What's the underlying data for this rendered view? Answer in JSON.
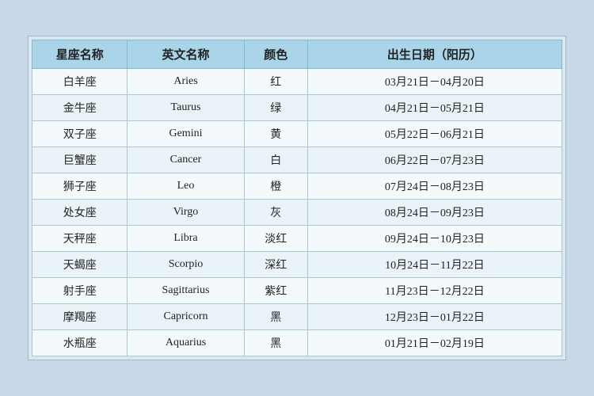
{
  "table": {
    "headers": {
      "zh_name": "星座名称",
      "en_name": "英文名称",
      "color": "颜色",
      "date": "出生日期（阳历）"
    },
    "rows": [
      {
        "zh": "白羊座",
        "en": "Aries",
        "color": "红",
        "date": "03月21日－04月20日"
      },
      {
        "zh": "金牛座",
        "en": "Taurus",
        "color": "绿",
        "date": "04月21日－05月21日"
      },
      {
        "zh": "双子座",
        "en": "Gemini",
        "color": "黄",
        "date": "05月22日－06月21日"
      },
      {
        "zh": "巨蟹座",
        "en": "Cancer",
        "color": "白",
        "date": "06月22日－07月23日"
      },
      {
        "zh": "狮子座",
        "en": "Leo",
        "color": "橙",
        "date": "07月24日－08月23日"
      },
      {
        "zh": "处女座",
        "en": "Virgo",
        "color": "灰",
        "date": "08月24日－09月23日"
      },
      {
        "zh": "天秤座",
        "en": "Libra",
        "color": "淡红",
        "date": "09月24日－10月23日"
      },
      {
        "zh": "天蝎座",
        "en": "Scorpio",
        "color": "深红",
        "date": "10月24日－11月22日"
      },
      {
        "zh": "射手座",
        "en": "Sagittarius",
        "color": "紫红",
        "date": "11月23日－12月22日"
      },
      {
        "zh": "摩羯座",
        "en": "Capricorn",
        "color": "黑",
        "date": "12月23日－01月22日"
      },
      {
        "zh": "水瓶座",
        "en": "Aquarius",
        "color": "黑",
        "date": "01月21日－02月19日"
      }
    ]
  }
}
